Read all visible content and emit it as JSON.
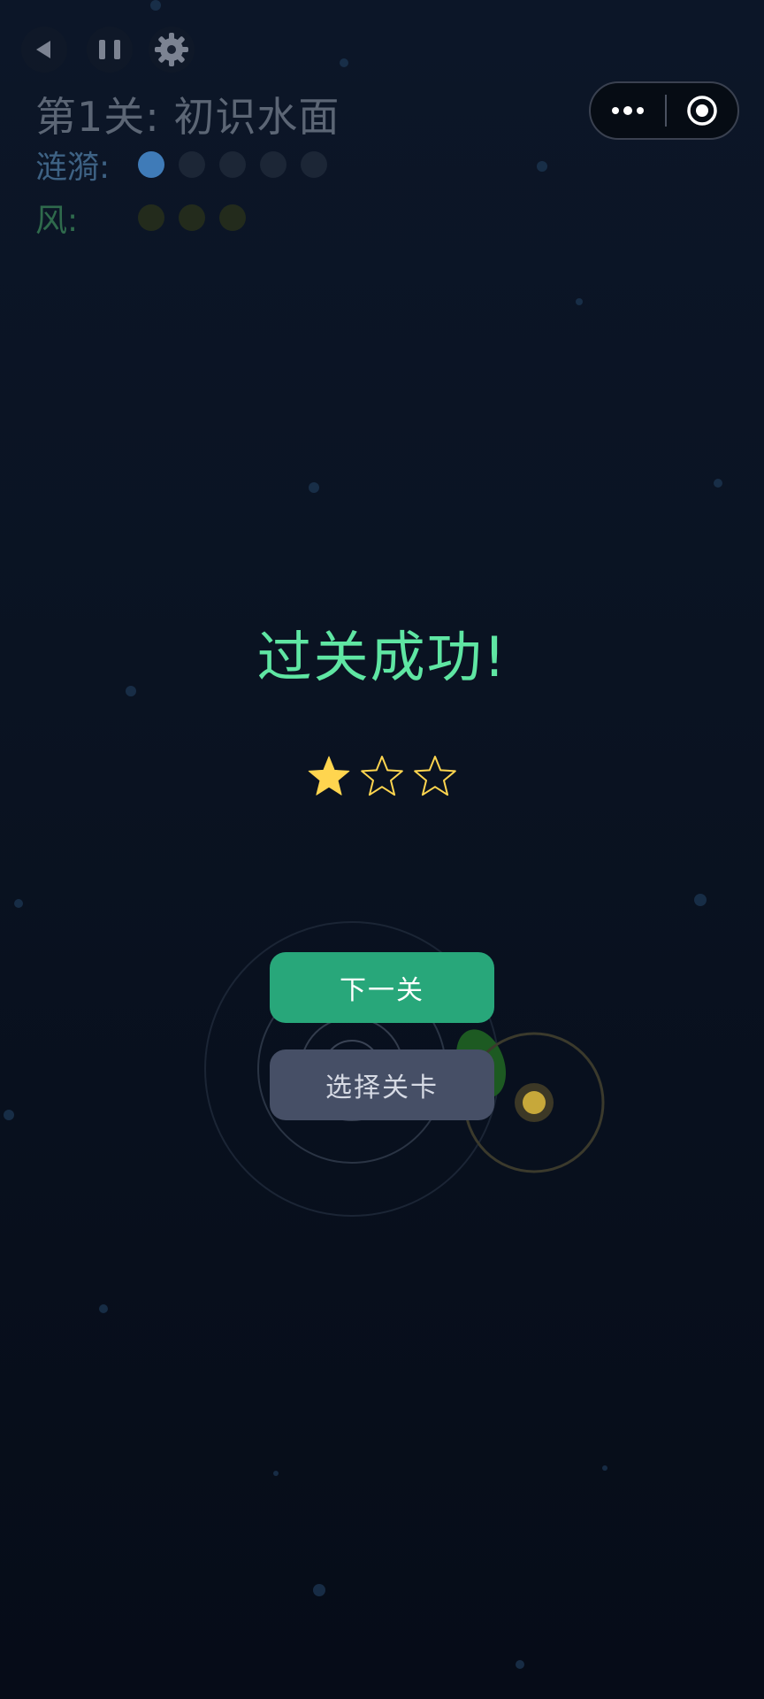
{
  "level": {
    "title": "第1关: 初识水面"
  },
  "hud": {
    "ripple_label": "涟漪:",
    "ripple_total": 5,
    "ripple_remaining": 1,
    "wind_label": "风:",
    "wind_total": 3,
    "wind_remaining": 0
  },
  "controls": {
    "back_icon": "back-icon",
    "pause_icon": "pause-icon",
    "settings_icon": "gear-icon"
  },
  "capsule": {
    "more_icon": "more-icon",
    "close_icon": "target-icon"
  },
  "result": {
    "title": "过关成功!",
    "stars_earned": 1,
    "stars_total": 3
  },
  "buttons": {
    "next_label": "下一关",
    "select_label": "选择关卡"
  },
  "colors": {
    "success": "#5fe6a3",
    "star": "#ffd54f",
    "next_button": "#28a77a",
    "select_button": "#464f66",
    "ripple_dot": "#3f7bb8"
  }
}
